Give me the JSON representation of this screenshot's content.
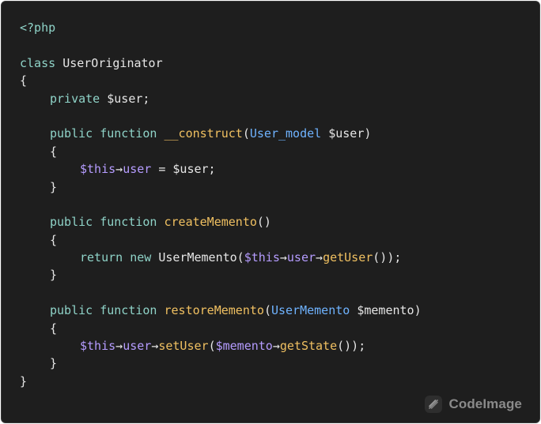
{
  "editor": {
    "lines": [
      {
        "indent": 0,
        "tokens": [
          {
            "t": "<?php",
            "k": "tag"
          }
        ]
      },
      {
        "indent": 0,
        "tokens": [
          {
            "t": "",
            "k": "plain"
          }
        ]
      },
      {
        "indent": 0,
        "tokens": [
          {
            "t": "class ",
            "k": "kw"
          },
          {
            "t": "UserOriginator",
            "k": "plain"
          }
        ]
      },
      {
        "indent": 0,
        "tokens": [
          {
            "t": "{",
            "k": "plain"
          }
        ]
      },
      {
        "indent": 1,
        "tokens": [
          {
            "t": "private ",
            "k": "kw"
          },
          {
            "t": "$user;",
            "k": "plain"
          }
        ]
      },
      {
        "indent": 0,
        "tokens": [
          {
            "t": "",
            "k": "plain"
          }
        ]
      },
      {
        "indent": 1,
        "tokens": [
          {
            "t": "public ",
            "k": "kw"
          },
          {
            "t": "function ",
            "k": "kw"
          },
          {
            "t": "__construct",
            "k": "fn"
          },
          {
            "t": "(",
            "k": "plain"
          },
          {
            "t": "User_model",
            "k": "type"
          },
          {
            "t": " $user)",
            "k": "plain"
          }
        ]
      },
      {
        "indent": 1,
        "tokens": [
          {
            "t": "{",
            "k": "plain"
          }
        ]
      },
      {
        "indent": 2,
        "tokens": [
          {
            "t": "$this",
            "k": "var"
          },
          {
            "t": "→",
            "k": "plain"
          },
          {
            "t": "user",
            "k": "var"
          },
          {
            "t": " = $user;",
            "k": "plain"
          }
        ]
      },
      {
        "indent": 1,
        "tokens": [
          {
            "t": "}",
            "k": "plain"
          }
        ]
      },
      {
        "indent": 0,
        "tokens": [
          {
            "t": "",
            "k": "plain"
          }
        ]
      },
      {
        "indent": 1,
        "tokens": [
          {
            "t": "public ",
            "k": "kw"
          },
          {
            "t": "function ",
            "k": "kw"
          },
          {
            "t": "createMemento",
            "k": "fn"
          },
          {
            "t": "()",
            "k": "plain"
          }
        ]
      },
      {
        "indent": 1,
        "tokens": [
          {
            "t": "{",
            "k": "plain"
          }
        ]
      },
      {
        "indent": 2,
        "tokens": [
          {
            "t": "return ",
            "k": "kw"
          },
          {
            "t": "new ",
            "k": "kw"
          },
          {
            "t": "UserMemento(",
            "k": "plain"
          },
          {
            "t": "$this",
            "k": "var"
          },
          {
            "t": "→",
            "k": "plain"
          },
          {
            "t": "user",
            "k": "var"
          },
          {
            "t": "→",
            "k": "plain"
          },
          {
            "t": "getUser",
            "k": "fn"
          },
          {
            "t": "());",
            "k": "plain"
          }
        ]
      },
      {
        "indent": 1,
        "tokens": [
          {
            "t": "}",
            "k": "plain"
          }
        ]
      },
      {
        "indent": 0,
        "tokens": [
          {
            "t": "",
            "k": "plain"
          }
        ]
      },
      {
        "indent": 1,
        "tokens": [
          {
            "t": "public ",
            "k": "kw"
          },
          {
            "t": "function ",
            "k": "kw"
          },
          {
            "t": "restoreMemento",
            "k": "fn"
          },
          {
            "t": "(",
            "k": "plain"
          },
          {
            "t": "UserMemento",
            "k": "type"
          },
          {
            "t": " $memento)",
            "k": "plain"
          }
        ]
      },
      {
        "indent": 1,
        "tokens": [
          {
            "t": "{",
            "k": "plain"
          }
        ]
      },
      {
        "indent": 2,
        "tokens": [
          {
            "t": "$this",
            "k": "var"
          },
          {
            "t": "→",
            "k": "plain"
          },
          {
            "t": "user",
            "k": "var"
          },
          {
            "t": "→",
            "k": "plain"
          },
          {
            "t": "setUser",
            "k": "fn"
          },
          {
            "t": "(",
            "k": "plain"
          },
          {
            "t": "$memento",
            "k": "var"
          },
          {
            "t": "→",
            "k": "plain"
          },
          {
            "t": "getState",
            "k": "fn"
          },
          {
            "t": "());",
            "k": "plain"
          }
        ]
      },
      {
        "indent": 1,
        "tokens": [
          {
            "t": "}",
            "k": "plain"
          }
        ]
      },
      {
        "indent": 0,
        "tokens": [
          {
            "t": "}",
            "k": "plain"
          }
        ]
      }
    ]
  },
  "watermark": {
    "label": "CodeImage",
    "icon": "codeimage-logo-icon"
  },
  "colors": {
    "background": "#1e1e1e",
    "plain": "#e6e6e6",
    "keyword": "#8fd3c8",
    "function": "#f0c061",
    "type": "#6fb3ff",
    "variable": "#b59cff",
    "watermark": "#8a8a8a"
  }
}
